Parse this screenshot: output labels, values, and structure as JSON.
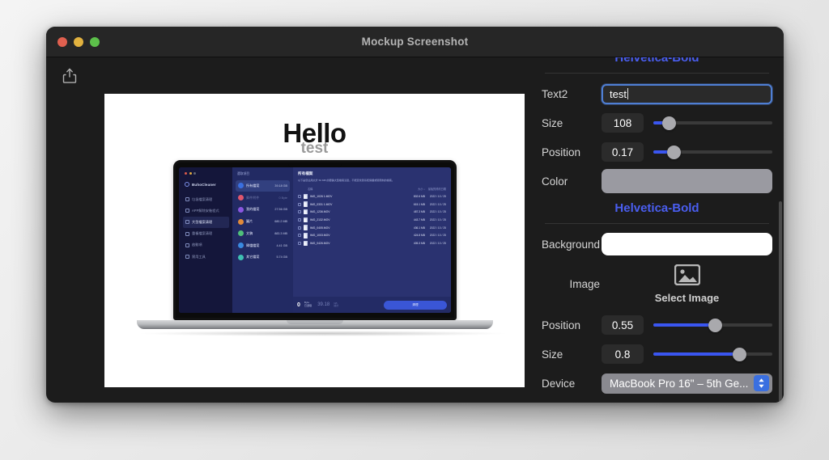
{
  "window": {
    "title": "Mockup Screenshot",
    "traffic_lights": [
      "close",
      "minimize",
      "zoom"
    ],
    "share_icon": "share-icon"
  },
  "canvas": {
    "heading": "Hello",
    "subheading": "test",
    "background_color": "#ffffff",
    "device_mockup": {
      "device": "MacBook Pro 16\"",
      "screen_app": {
        "brand": "BuhoCleaner",
        "sidebar_items": [
          "垃圾檔案清理",
          "APP解除安裝程式",
          "大型檔案清理",
          "重複檔案清理",
          "啟動項",
          "實用工具"
        ],
        "breadcrumb": "選取項目",
        "categories": [
          {
            "name": "所有檔案",
            "size": "39.18 GB",
            "selected": true,
            "color": "#3a6fe0"
          },
          {
            "name": "郵件附件",
            "size": "0 Byte",
            "selected": false,
            "color": "#e0566d"
          },
          {
            "name": "我的檔案",
            "size": "27.56 GB",
            "selected": false,
            "color": "#8a56e0"
          },
          {
            "name": "圖片",
            "size": "680.2 MB",
            "selected": false,
            "color": "#e08a3a"
          },
          {
            "name": "文稿",
            "size": "883.3 MB",
            "selected": false,
            "color": "#4fc07a"
          },
          {
            "name": "歸檔檔案",
            "size": "4.41 GB",
            "selected": false,
            "color": "#3a8ae0"
          },
          {
            "name": "其它檔案",
            "size": "5.74 GB",
            "selected": false,
            "color": "#3fc0b2"
          }
        ],
        "main_title": "所有檔案",
        "main_desc": "以下是您佔用大於 50 MB 的硬碟大型檔案清單。不能查找受系統保護或受限制的檔案。",
        "table_headers": {
          "name": "名稱",
          "size": "大小 ↓",
          "date": "最後的修改日期"
        },
        "files": [
          {
            "name": "IMG_1026 1.MOV",
            "size": "802.6 MB",
            "date": "2022 / 10 / 25"
          },
          {
            "name": "IMG_0331 1.MOV",
            "size": "615.1 MB",
            "date": "2022 / 10 / 25"
          },
          {
            "name": "IMG_1236.MOV",
            "size": "487.3 MB",
            "date": "2022 / 10 / 25"
          },
          {
            "name": "IMG_2132.MOV",
            "size": "443.7 MB",
            "date": "2022 / 10 / 25"
          },
          {
            "name": "IMG_0405.MOV",
            "size": "436.1 MB",
            "date": "2022 / 10 / 25"
          },
          {
            "name": "IMG_1003.MOV",
            "size": "424.8 MB",
            "date": "2022 / 10 / 25"
          },
          {
            "name": "IMG_0426.MOV",
            "size": "405.3 MB",
            "date": "2022 / 10 / 25"
          }
        ],
        "footer": {
          "selected_value": "0",
          "selected_unit": "Byte",
          "selected_unit2": "已選取",
          "total_value": "39.18",
          "total_unit": "GB",
          "total_unit2": "總計",
          "action_label": "清理"
        }
      }
    }
  },
  "panel": {
    "font_top": "Helvetica-Bold",
    "font_bottom": "Helvetica-Bold",
    "accent_color": "#4a5ef0",
    "text2": {
      "label": "Text2",
      "value": "test",
      "placeholder": ""
    },
    "size": {
      "label": "Size",
      "value": "108",
      "fill_pct": 13
    },
    "position": {
      "label": "Position",
      "value": "0.17",
      "fill_pct": 17
    },
    "color": {
      "label": "Color",
      "swatch": "#9a9aa1"
    },
    "background": {
      "label": "Background",
      "swatch": "#ffffff"
    },
    "image": {
      "label": "Image",
      "select_label": "Select Image",
      "icon": "picture-icon"
    },
    "image_position": {
      "label": "Position",
      "value": "0.55",
      "fill_pct": 52
    },
    "image_size": {
      "label": "Size",
      "value": "0.8",
      "fill_pct": 72
    },
    "device": {
      "label": "Device",
      "value": "MacBook Pro 16\" – 5th Ge...",
      "chevron_icon": "chevron-up-down-icon"
    }
  }
}
